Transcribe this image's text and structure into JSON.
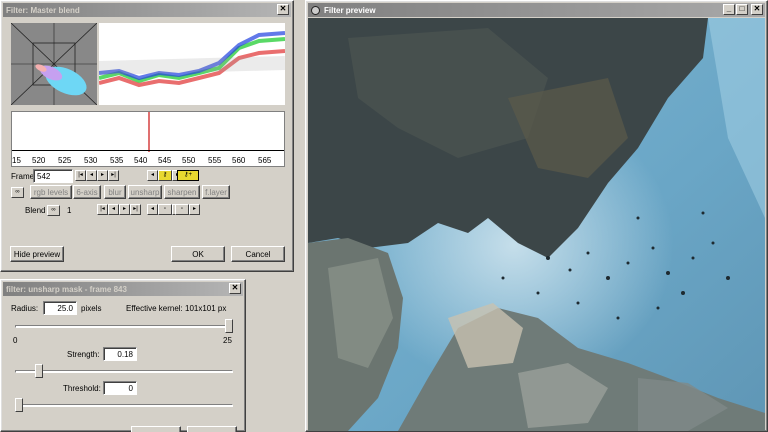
{
  "master_blend": {
    "title": "Filter: Master blend",
    "close_glyph": "✕",
    "timeline_ticks": [
      "15",
      "520",
      "525",
      "530",
      "535",
      "540",
      "545",
      "550",
      "555",
      "560",
      "565"
    ],
    "frame_label": "Frame",
    "frame_value": "542",
    "filter_buttons": [
      "rgb levels",
      "6-axis",
      "blur",
      "unsharp",
      "sharpen",
      "f.layer"
    ],
    "blend_label": "Blend",
    "blend_value": "1",
    "hide_preview_label": "Hide preview",
    "ok_label": "OK",
    "cancel_label": "Cancel"
  },
  "unsharp": {
    "title": "filter: unsharp mask - frame 843",
    "close_glyph": "✕",
    "radius_label": "Radius:",
    "radius_value": "25.0",
    "radius_unit": "pixels",
    "kernel_text": "Effective kernel: 101x101 px",
    "radius_min": "0",
    "radius_max": "25",
    "strength_label": "Strength:",
    "strength_value": "0.18",
    "threshold_label": "Threshold:",
    "threshold_value": "0"
  },
  "preview": {
    "title": "Filter preview",
    "min_glyph": "_",
    "max_glyph": "□",
    "close_glyph": "✕"
  },
  "colors": {
    "inactive_title": "#808080",
    "timeline_marker": "#e07070",
    "water": "#6fa9c8"
  }
}
